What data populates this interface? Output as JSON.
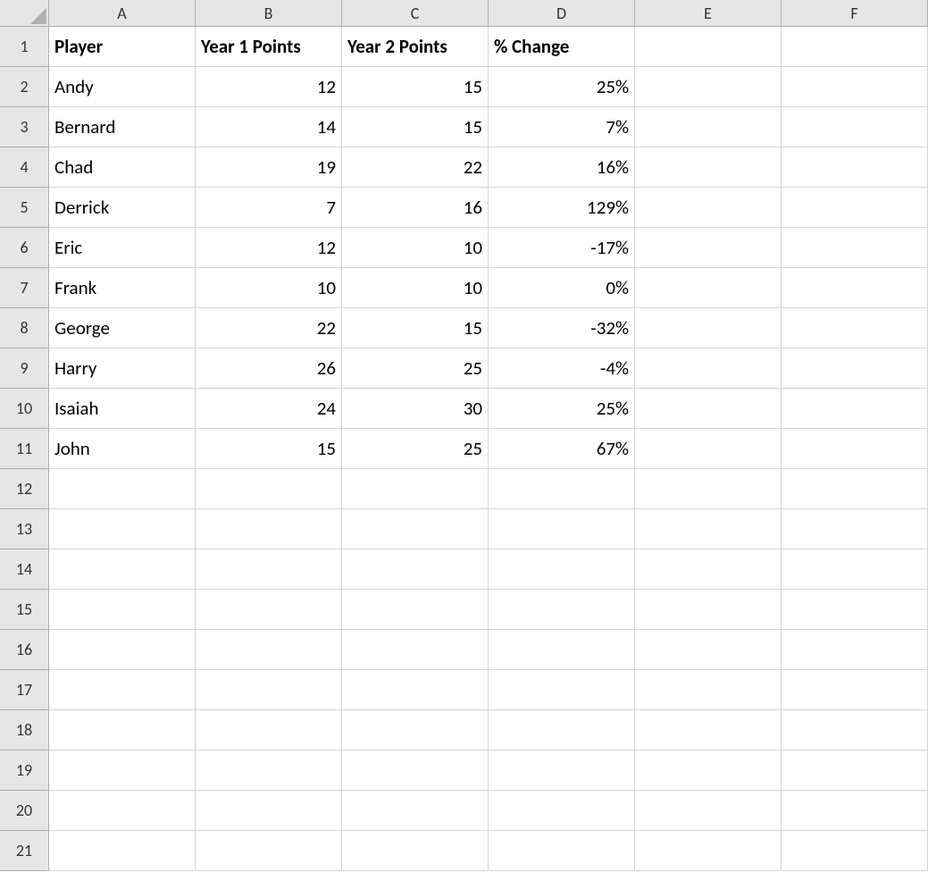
{
  "columns": [
    "A",
    "B",
    "C",
    "D",
    "E",
    "F"
  ],
  "row_count": 21,
  "headers": {
    "A": "Player",
    "B": "Year 1 Points",
    "C": "Year 2 Points",
    "D": "% Change"
  },
  "rows": [
    {
      "player": "Andy",
      "y1": "12",
      "y2": "15",
      "pct": "25%"
    },
    {
      "player": "Bernard",
      "y1": "14",
      "y2": "15",
      "pct": "7%"
    },
    {
      "player": "Chad",
      "y1": "19",
      "y2": "22",
      "pct": "16%"
    },
    {
      "player": "Derrick",
      "y1": "7",
      "y2": "16",
      "pct": "129%"
    },
    {
      "player": "Eric",
      "y1": "12",
      "y2": "10",
      "pct": "-17%"
    },
    {
      "player": "Frank",
      "y1": "10",
      "y2": "10",
      "pct": "0%"
    },
    {
      "player": "George",
      "y1": "22",
      "y2": "15",
      "pct": "-32%"
    },
    {
      "player": "Harry",
      "y1": "26",
      "y2": "25",
      "pct": "-4%"
    },
    {
      "player": "Isaiah",
      "y1": "24",
      "y2": "30",
      "pct": "25%"
    },
    {
      "player": "John",
      "y1": "15",
      "y2": "25",
      "pct": "67%"
    }
  ]
}
